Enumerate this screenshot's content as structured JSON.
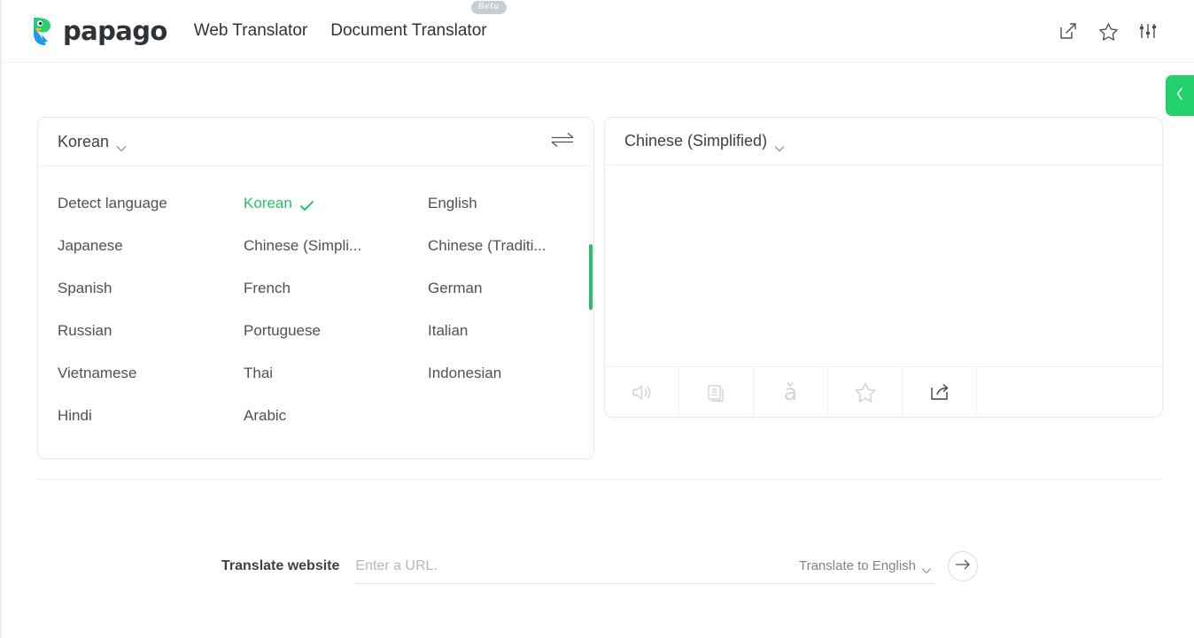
{
  "header": {
    "logo_text": "papago",
    "logo_icon": "papago-parrot-logo",
    "nav": [
      {
        "label": "Web Translator",
        "badge": null
      },
      {
        "label": "Document Translator",
        "badge": "Beta"
      }
    ],
    "actions": [
      {
        "icon": "external-link-icon"
      },
      {
        "icon": "star-icon"
      },
      {
        "icon": "settings-sliders-icon"
      }
    ]
  },
  "source_panel": {
    "selected_language": "Korean",
    "dropdown_open": true,
    "swap_icon": "swap-arrows-icon",
    "languages": [
      {
        "label": "Detect language",
        "selected": false
      },
      {
        "label": "Korean",
        "selected": true
      },
      {
        "label": "English",
        "selected": false
      },
      {
        "label": "Japanese",
        "selected": false
      },
      {
        "label": "Chinese (Simpli...",
        "selected": false
      },
      {
        "label": "Chinese (Traditi...",
        "selected": false
      },
      {
        "label": "Spanish",
        "selected": false
      },
      {
        "label": "French",
        "selected": false
      },
      {
        "label": "German",
        "selected": false
      },
      {
        "label": "Russian",
        "selected": false
      },
      {
        "label": "Portuguese",
        "selected": false
      },
      {
        "label": "Italian",
        "selected": false
      },
      {
        "label": "Vietnamese",
        "selected": false
      },
      {
        "label": "Thai",
        "selected": false
      },
      {
        "label": "Indonesian",
        "selected": false
      },
      {
        "label": "Hindi",
        "selected": false
      },
      {
        "label": "Arabic",
        "selected": false
      },
      {
        "label": "",
        "selected": false
      }
    ]
  },
  "target_panel": {
    "selected_language": "Chinese (Simplified)",
    "result_text": "",
    "tools": [
      {
        "icon": "speaker-sound-icon",
        "active": false
      },
      {
        "icon": "copy-document-icon",
        "active": false
      },
      {
        "icon": "pinyin-icon",
        "label": "ǎ",
        "active": false
      },
      {
        "icon": "star-icon",
        "active": false
      },
      {
        "icon": "share-icon",
        "active": true
      }
    ]
  },
  "side_tab": {
    "icon": "chevron-left-icon"
  },
  "web_translate": {
    "label": "Translate website",
    "url_value": "",
    "url_placeholder": "Enter a URL.",
    "target_label": "Translate to English",
    "go_icon": "arrow-right-icon"
  },
  "colors": {
    "accent_green": "#23d06b",
    "selected_green": "#26c46a",
    "text_primary": "#3c4248",
    "text_muted": "#7e8589",
    "border": "#e8eaec",
    "badge_gray": "#c7cdd2"
  }
}
